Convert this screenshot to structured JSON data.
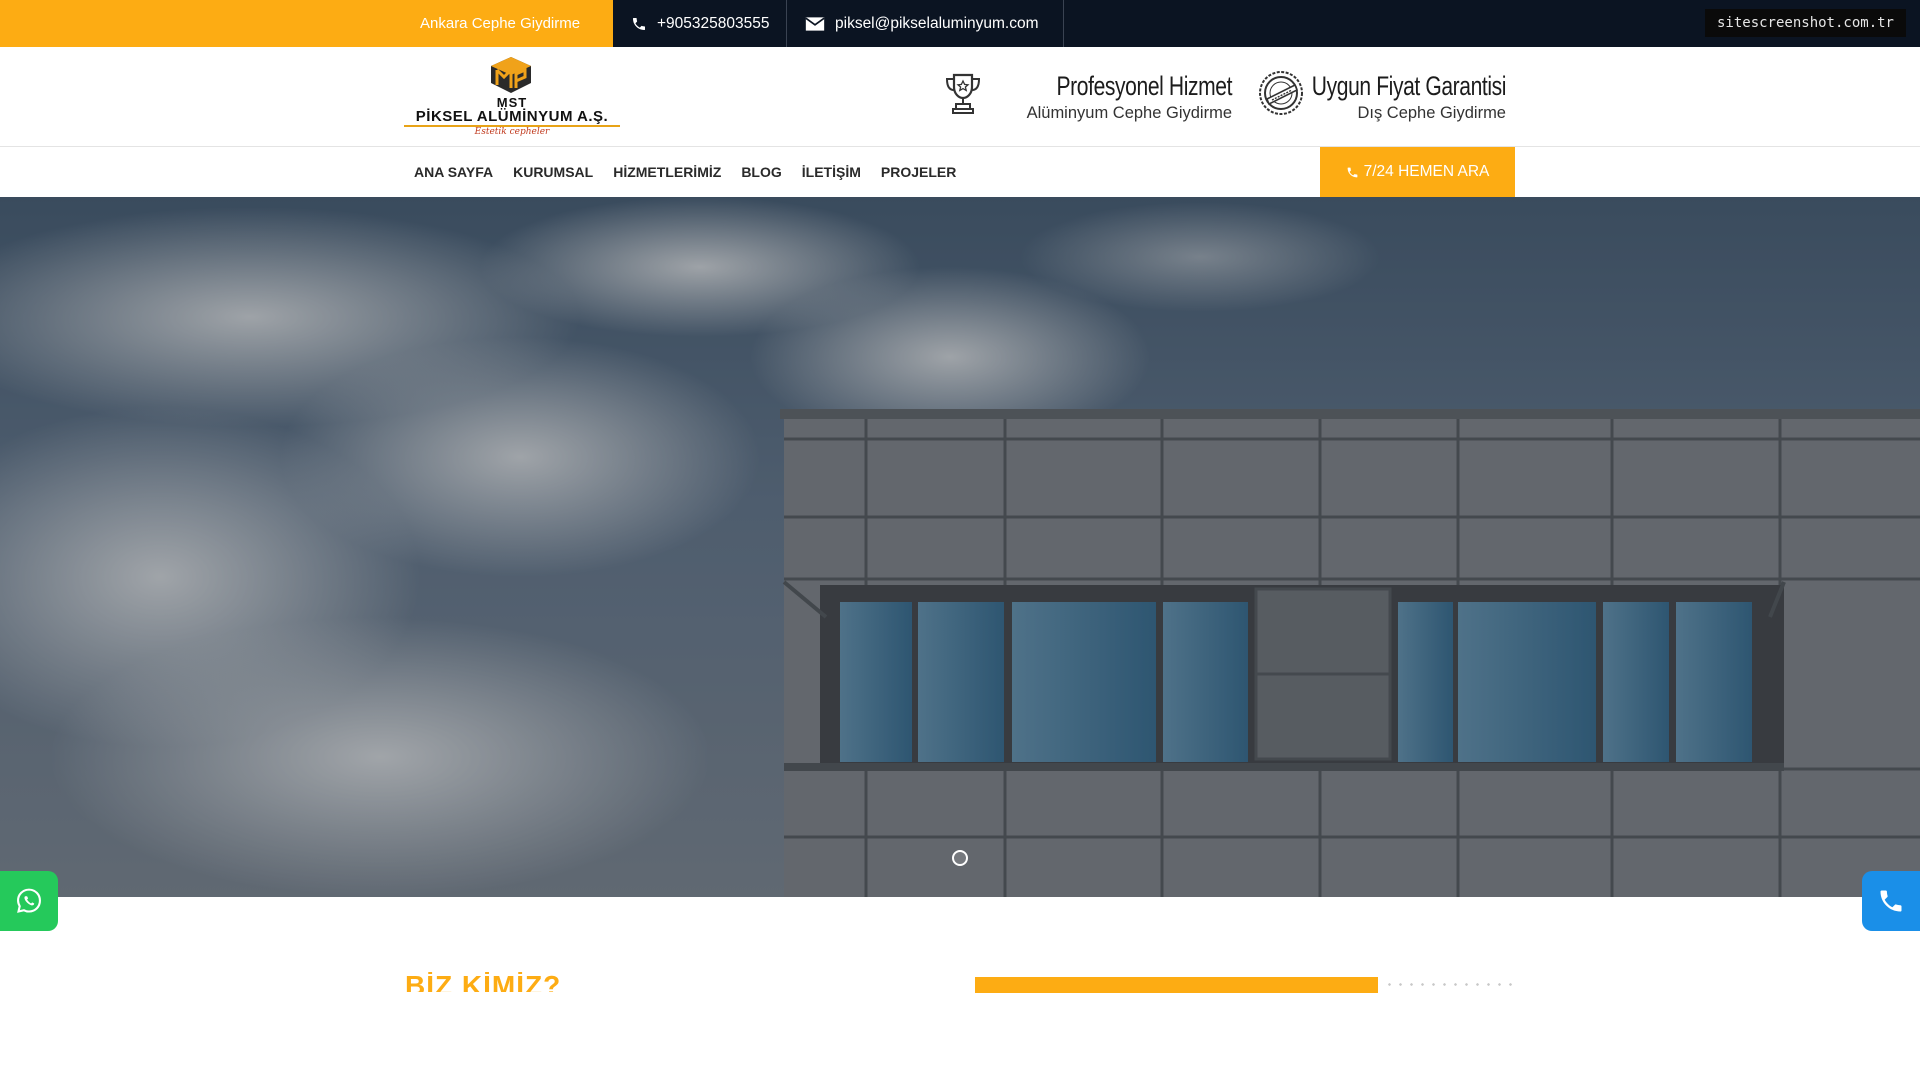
{
  "topbar": {
    "tagline": "Ankara Cephe Giydirme",
    "phone": "+905325803555",
    "email": "piksel@pikselaluminyum.com",
    "watermark": "sitescreenshot.com.tr"
  },
  "logo": {
    "line1": "MST",
    "line2": "PİKSEL ALÜMİNYUM A.Ş.",
    "slogan": "Estetik cepheler"
  },
  "features": [
    {
      "title": "Profesyonel Hizmet",
      "subtitle": "Alüminyum Cephe Giydirme",
      "icon": "trophy-icon"
    },
    {
      "title": "Uygun Fiyat Garantisi",
      "subtitle": "Dış Cephe Giydirme",
      "icon": "approved-badge-icon"
    }
  ],
  "nav": {
    "items": [
      "ANA SAYFA",
      "KURUMSAL",
      "HİZMETLERİMİZ",
      "BLOG",
      "İLETİŞİM",
      "PROJELER"
    ],
    "call_label": "7/24 HEMEN ARA"
  },
  "hero": {
    "slide_count": 1,
    "active_slide": 1
  },
  "about": {
    "title": "BİZ KİMİZ?",
    "progress_fraction": 0.75
  },
  "colors": {
    "accent": "#fdac13",
    "dark": "#0b1422",
    "whatsapp": "#25c95b",
    "call": "#1a8fe8"
  }
}
